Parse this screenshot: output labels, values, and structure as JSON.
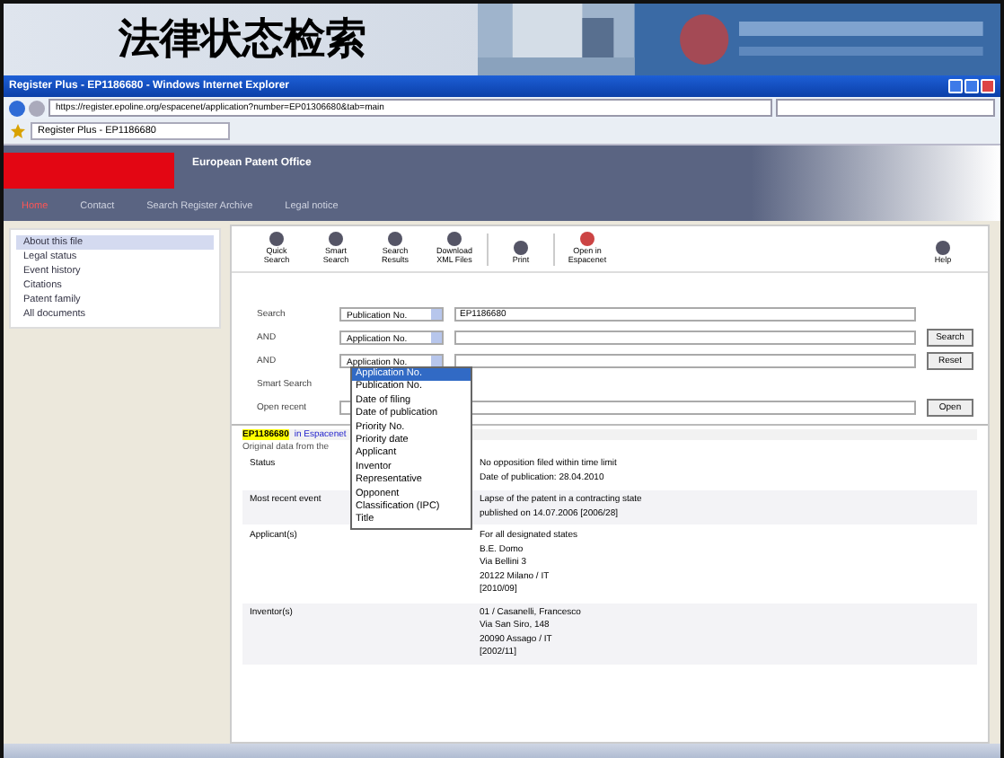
{
  "slide": {
    "title": "法律状态检索"
  },
  "browser": {
    "title": "Register Plus - EP1186680 - Windows Internet Explorer",
    "address": "https://register.epoline.org/espacenet/application?number=EP01306680&tab=main",
    "tab": "Register Plus - EP1186680"
  },
  "site": {
    "name": "European Patent Office",
    "nav": [
      {
        "label": "Home",
        "selected": true
      },
      {
        "label": "Contact",
        "selected": false
      },
      {
        "label": "Search Register Archive",
        "selected": false
      },
      {
        "label": "Legal notice",
        "selected": false
      }
    ]
  },
  "sidebar": {
    "items": [
      {
        "label": "About this file",
        "selected": true
      },
      {
        "label": "Legal status",
        "selected": false
      },
      {
        "label": "Event history",
        "selected": false
      },
      {
        "label": "Citations",
        "selected": false
      },
      {
        "label": "Patent family",
        "selected": false
      },
      {
        "label": "All documents",
        "selected": false
      }
    ]
  },
  "toolbar": [
    {
      "label": "Quick Search"
    },
    {
      "label": "Smart Search"
    },
    {
      "label": "Search Results"
    },
    {
      "label": "Download XML Files"
    },
    {
      "label": "Print"
    },
    {
      "label": "Open in Espacenet"
    },
    {
      "label": "Help"
    }
  ],
  "form": {
    "rows": [
      {
        "label": "Search",
        "select": "Publication No.",
        "value": "EP1186680",
        "button": ""
      },
      {
        "label": "AND",
        "select": "Application No.",
        "value": "",
        "button": "Search"
      },
      {
        "label": "AND",
        "select": "Application No.",
        "value": "",
        "button": "Reset"
      }
    ],
    "extra": [
      {
        "label": "Smart Search"
      },
      {
        "label": "Open recent",
        "button": "Open"
      }
    ],
    "options": [
      {
        "label": "Application No.",
        "selected": true
      },
      {
        "label": "Publication No.",
        "selected": false
      },
      {
        "label": "Date of filing",
        "selected": false
      },
      {
        "label": "Date of publication",
        "selected": false
      },
      {
        "label": "Priority No.",
        "selected": false
      },
      {
        "label": "Priority date",
        "selected": false
      },
      {
        "label": "Applicant",
        "selected": false
      },
      {
        "label": "Inventor",
        "selected": false
      },
      {
        "label": "Representative",
        "selected": false
      },
      {
        "label": "Opponent",
        "selected": false
      },
      {
        "label": "Classification (IPC)",
        "selected": false
      },
      {
        "label": "Title",
        "selected": false
      }
    ]
  },
  "result": {
    "highlight": "EP1186680",
    "link": "in Espacenet",
    "note": "Original data from the",
    "rows": [
      {
        "label": "Status",
        "lines": [
          "No opposition filed within time limit",
          "Date of publication: 28.04.2010"
        ]
      },
      {
        "label": "Most recent event",
        "lines": [
          "Lapse of the patent in a contracting state",
          "published on 14.07.2006 [2006/28]"
        ]
      },
      {
        "label": "Applicant(s)",
        "lines": [
          "For all designated states",
          "B.E. Domo",
          "Via Bellini 3",
          "20122 Milano / IT",
          "[2010/09]"
        ]
      },
      {
        "label": "Inventor(s)",
        "lines": [
          "01 / Casanelli, Francesco",
          "Via San Siro, 148",
          "20090 Assago / IT",
          "[2002/11]"
        ]
      }
    ]
  }
}
